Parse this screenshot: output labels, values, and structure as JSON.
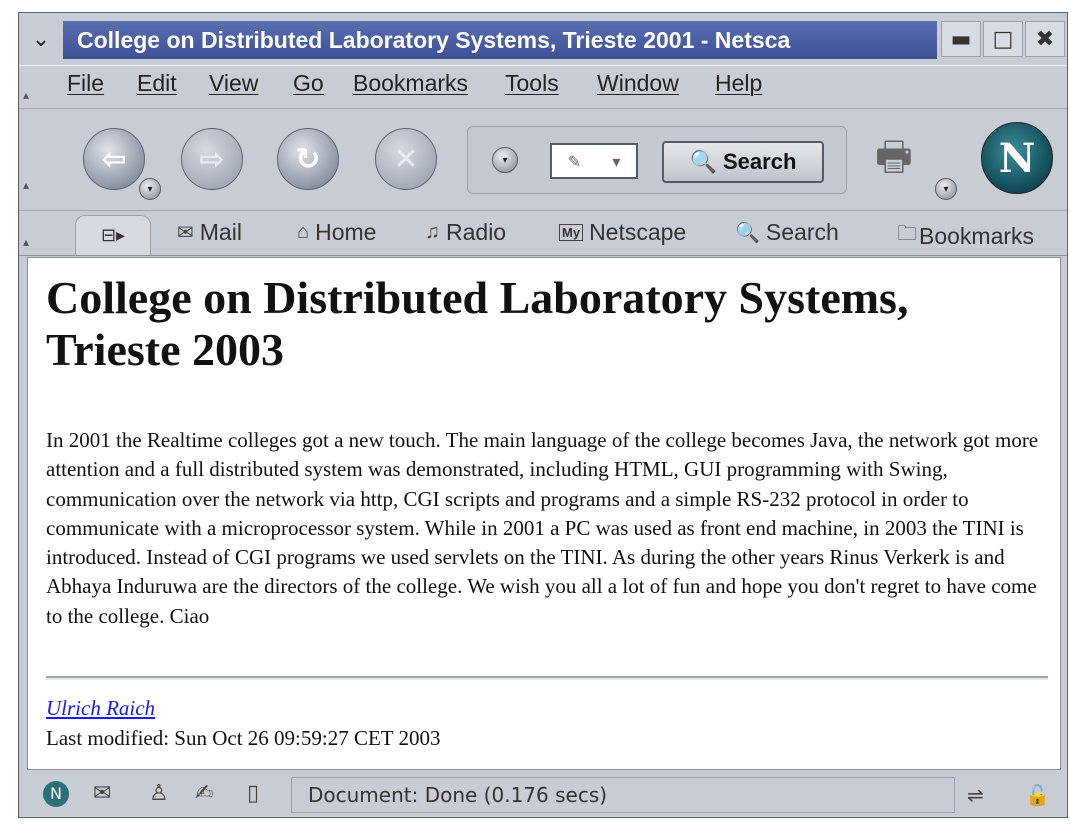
{
  "window": {
    "title": "College on Distributed Laboratory Systems, Trieste 2001 - Netsca",
    "sysmenu_icon": "chevron-down-icon",
    "minimize_glyph": "▬",
    "maximize_glyph": "□",
    "close_glyph": "✖"
  },
  "menubar": {
    "items": [
      "File",
      "Edit",
      "View",
      "Go",
      "Bookmarks",
      "Tools",
      "Window",
      "Help"
    ]
  },
  "navbar": {
    "back_glyph": "⇦",
    "forward_glyph": "⇨",
    "reload_glyph": "↻",
    "stop_glyph": "✕",
    "search_label": "Search",
    "logo_letter": "N"
  },
  "personal_toolbar": {
    "links": [
      {
        "label": "Mail",
        "icon": "envelope-icon"
      },
      {
        "label": "Home",
        "icon": "house-icon"
      },
      {
        "label": "Radio",
        "icon": "music-note-icon"
      },
      {
        "label": "Netscape",
        "icon": "my-icon",
        "icon_text": "My"
      },
      {
        "label": "Search",
        "icon": "magnifier-icon"
      },
      {
        "label": "Bookmarks",
        "icon": "folder-icon"
      }
    ]
  },
  "page": {
    "heading": "College on Distributed Laboratory Systems, Trieste 2003",
    "paragraph": "In 2001 the Realtime colleges got a new touch. The main language of the college becomes Java, the network got more attention and a full distributed system was demonstrated, including HTML, GUI programming with Swing, communication over the network via http, CGI scripts and programs and a simple RS-232 protocol in order to communicate with a microprocessor system. While in 2001 a PC was used as front end machine, in 2003 the TINI is introduced. Instead of CGI programs we used servlets on the TINI. As during the other years Rinus Verkerk is and Abhaya Induruwa are the directors of the college. We wish you all a lot of fun and hope you don't regret to have come to the college. Ciao",
    "author": "Ulrich Raich",
    "last_modified": "Last modified: Sun Oct 26 09:59:27 CET 2003"
  },
  "statusbar": {
    "status_text": "Document: Done (0.176 secs)",
    "logo_letter": "N"
  }
}
